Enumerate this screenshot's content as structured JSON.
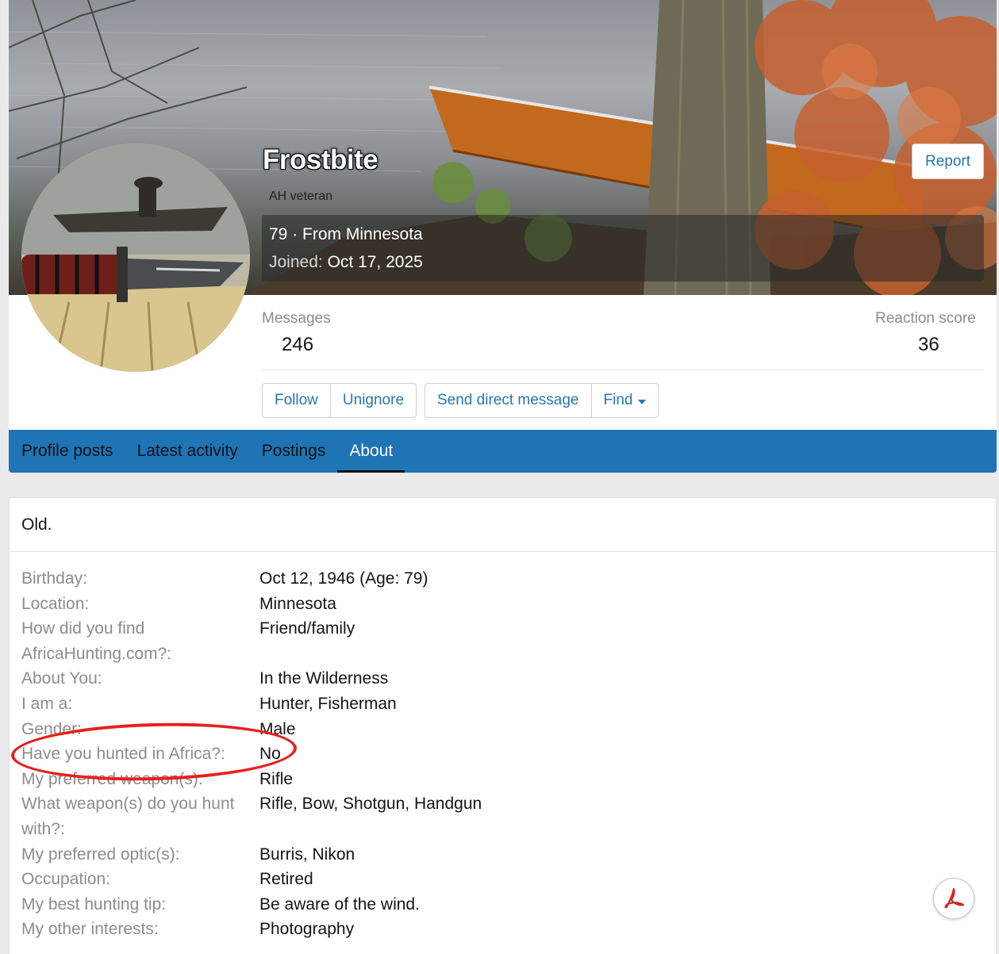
{
  "profile": {
    "username": "Frostbite",
    "user_title": "AH veteran",
    "age_location": "79 · From Minnesota",
    "joined_label": "Joined:",
    "joined_value": "Oct 17, 2025",
    "report_label": "Report",
    "stats": {
      "messages_label": "Messages",
      "messages_value": "246",
      "reaction_label": "Reaction score",
      "reaction_value": "36"
    },
    "actions": {
      "follow": "Follow",
      "unignore": "Unignore",
      "send_dm": "Send direct message",
      "find": "Find"
    }
  },
  "tabs": [
    {
      "label": "Profile posts",
      "active": false
    },
    {
      "label": "Latest activity",
      "active": false
    },
    {
      "label": "Postings",
      "active": false
    },
    {
      "label": "About",
      "active": true
    }
  ],
  "about": {
    "bio": "Old.",
    "fields": [
      {
        "label": "Birthday:",
        "value": "Oct 12, 1946 (Age: 79)"
      },
      {
        "label": "Location:",
        "value": "Minnesota"
      },
      {
        "label": "How did you find AfricaHunting.com?:",
        "value": "Friend/family"
      },
      {
        "label": "About You:",
        "value": "In the Wilderness"
      },
      {
        "label": "I am a:",
        "value": "Hunter, Fisherman"
      },
      {
        "label": "Gender:",
        "value": "Male"
      },
      {
        "label": "Have you hunted in Africa?:",
        "value": "No"
      },
      {
        "label": "My preferred weapon(s):",
        "value": "Rifle"
      },
      {
        "label": "What weapon(s) do you hunt with?:",
        "value": "Rifle, Bow, Shotgun, Handgun"
      },
      {
        "label": "My preferred optic(s):",
        "value": "Burris, Nikon"
      },
      {
        "label": "Occupation:",
        "value": "Retired"
      },
      {
        "label": "My best hunting tip:",
        "value": "Be aware of the wind."
      },
      {
        "label": "My other interests:",
        "value": "Photography"
      }
    ]
  },
  "colors": {
    "accent_blue": "#2577b1",
    "tab_bar": "#1f74b6",
    "annotation_red": "#e8201c"
  },
  "icons": {
    "pdf": "pdf-icon",
    "dropdown": "caret-down-icon"
  }
}
